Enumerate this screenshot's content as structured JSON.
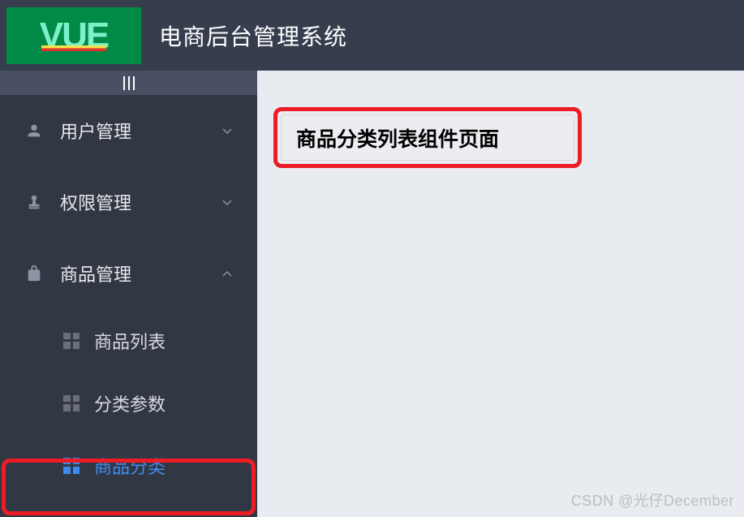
{
  "logo": "VUE",
  "appTitle": "电商后台管理系统",
  "sidebar": {
    "items": [
      {
        "label": "用户管理",
        "expanded": false
      },
      {
        "label": "权限管理",
        "expanded": false
      },
      {
        "label": "商品管理",
        "expanded": true
      }
    ],
    "submenu": [
      {
        "label": "商品列表",
        "active": false
      },
      {
        "label": "分类参数",
        "active": false
      },
      {
        "label": "商品分类",
        "active": true
      }
    ]
  },
  "main": {
    "pageTitle": "商品分类列表组件页面"
  },
  "watermark": "CSDN @光仔December"
}
